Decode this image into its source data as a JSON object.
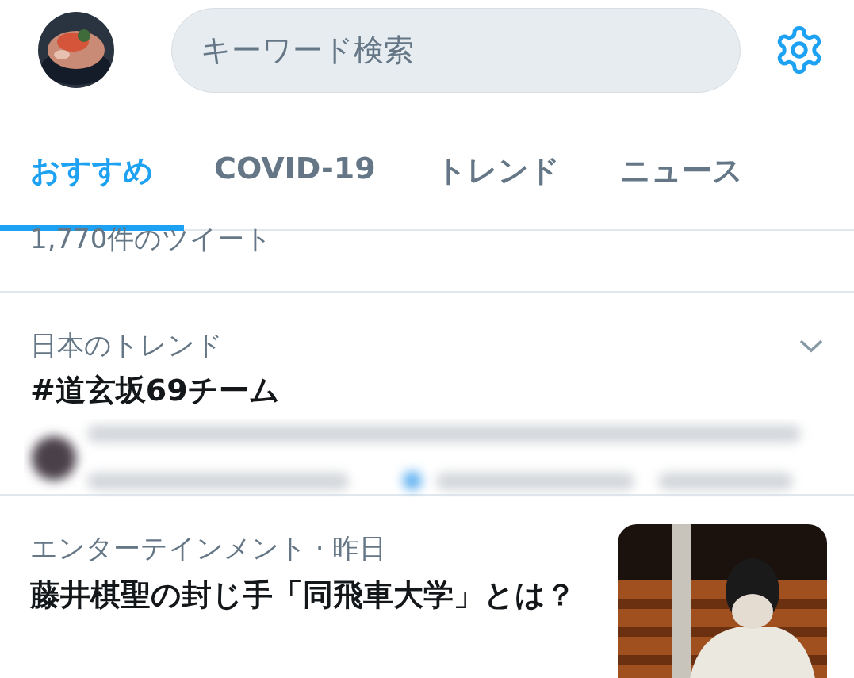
{
  "header": {
    "search": {
      "placeholder": "キーワード検索"
    }
  },
  "tabs": [
    {
      "label": "おすすめ",
      "selected": true
    },
    {
      "label": "COVID-19",
      "selected": false
    },
    {
      "label": "トレンド",
      "selected": false
    },
    {
      "label": "ニュース",
      "selected": false
    }
  ],
  "tweet_count": "1,770件のツイート",
  "trend": {
    "context": "日本のトレンド",
    "title": "#道玄坂69チーム",
    "preview": {
      "kind": "blurred"
    }
  },
  "news": {
    "context": "エンターテインメント · 昨日",
    "title": "藤井棋聖の封じ手「同飛車大学」とは？"
  }
}
